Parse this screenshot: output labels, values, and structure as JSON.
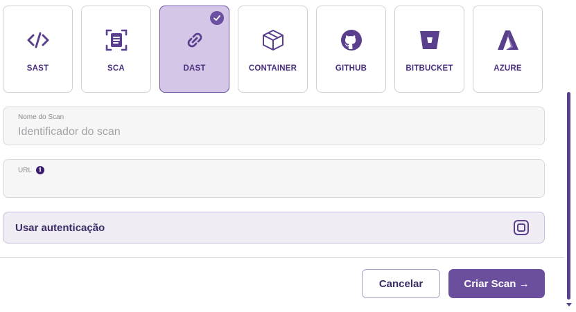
{
  "scan_types": [
    {
      "id": "sast",
      "label": "SAST",
      "icon": "code-icon",
      "selected": false
    },
    {
      "id": "sca",
      "label": "SCA",
      "icon": "document-scan-icon",
      "selected": false
    },
    {
      "id": "dast",
      "label": "DAST",
      "icon": "link-icon",
      "selected": true
    },
    {
      "id": "container",
      "label": "CONTAINER",
      "icon": "box-icon",
      "selected": false
    },
    {
      "id": "github",
      "label": "GITHUB",
      "icon": "github-icon",
      "selected": false
    },
    {
      "id": "bitbucket",
      "label": "BITBUCKET",
      "icon": "bitbucket-icon",
      "selected": false
    },
    {
      "id": "azure",
      "label": "AZURE",
      "icon": "azure-icon",
      "selected": false
    }
  ],
  "form": {
    "scan_name": {
      "label": "Nome do Scan",
      "placeholder": "Identificador do scan",
      "value": ""
    },
    "url": {
      "label": "URL",
      "value": ""
    },
    "auth": {
      "label": "Usar autenticação",
      "checked": false
    }
  },
  "actions": {
    "cancel_label": "Cancelar",
    "create_label": "Criar Scan →"
  },
  "colors": {
    "accent": "#6b4f9e",
    "selected_card_bg": "#d4c6e6",
    "text_primary": "#3b2a63"
  }
}
